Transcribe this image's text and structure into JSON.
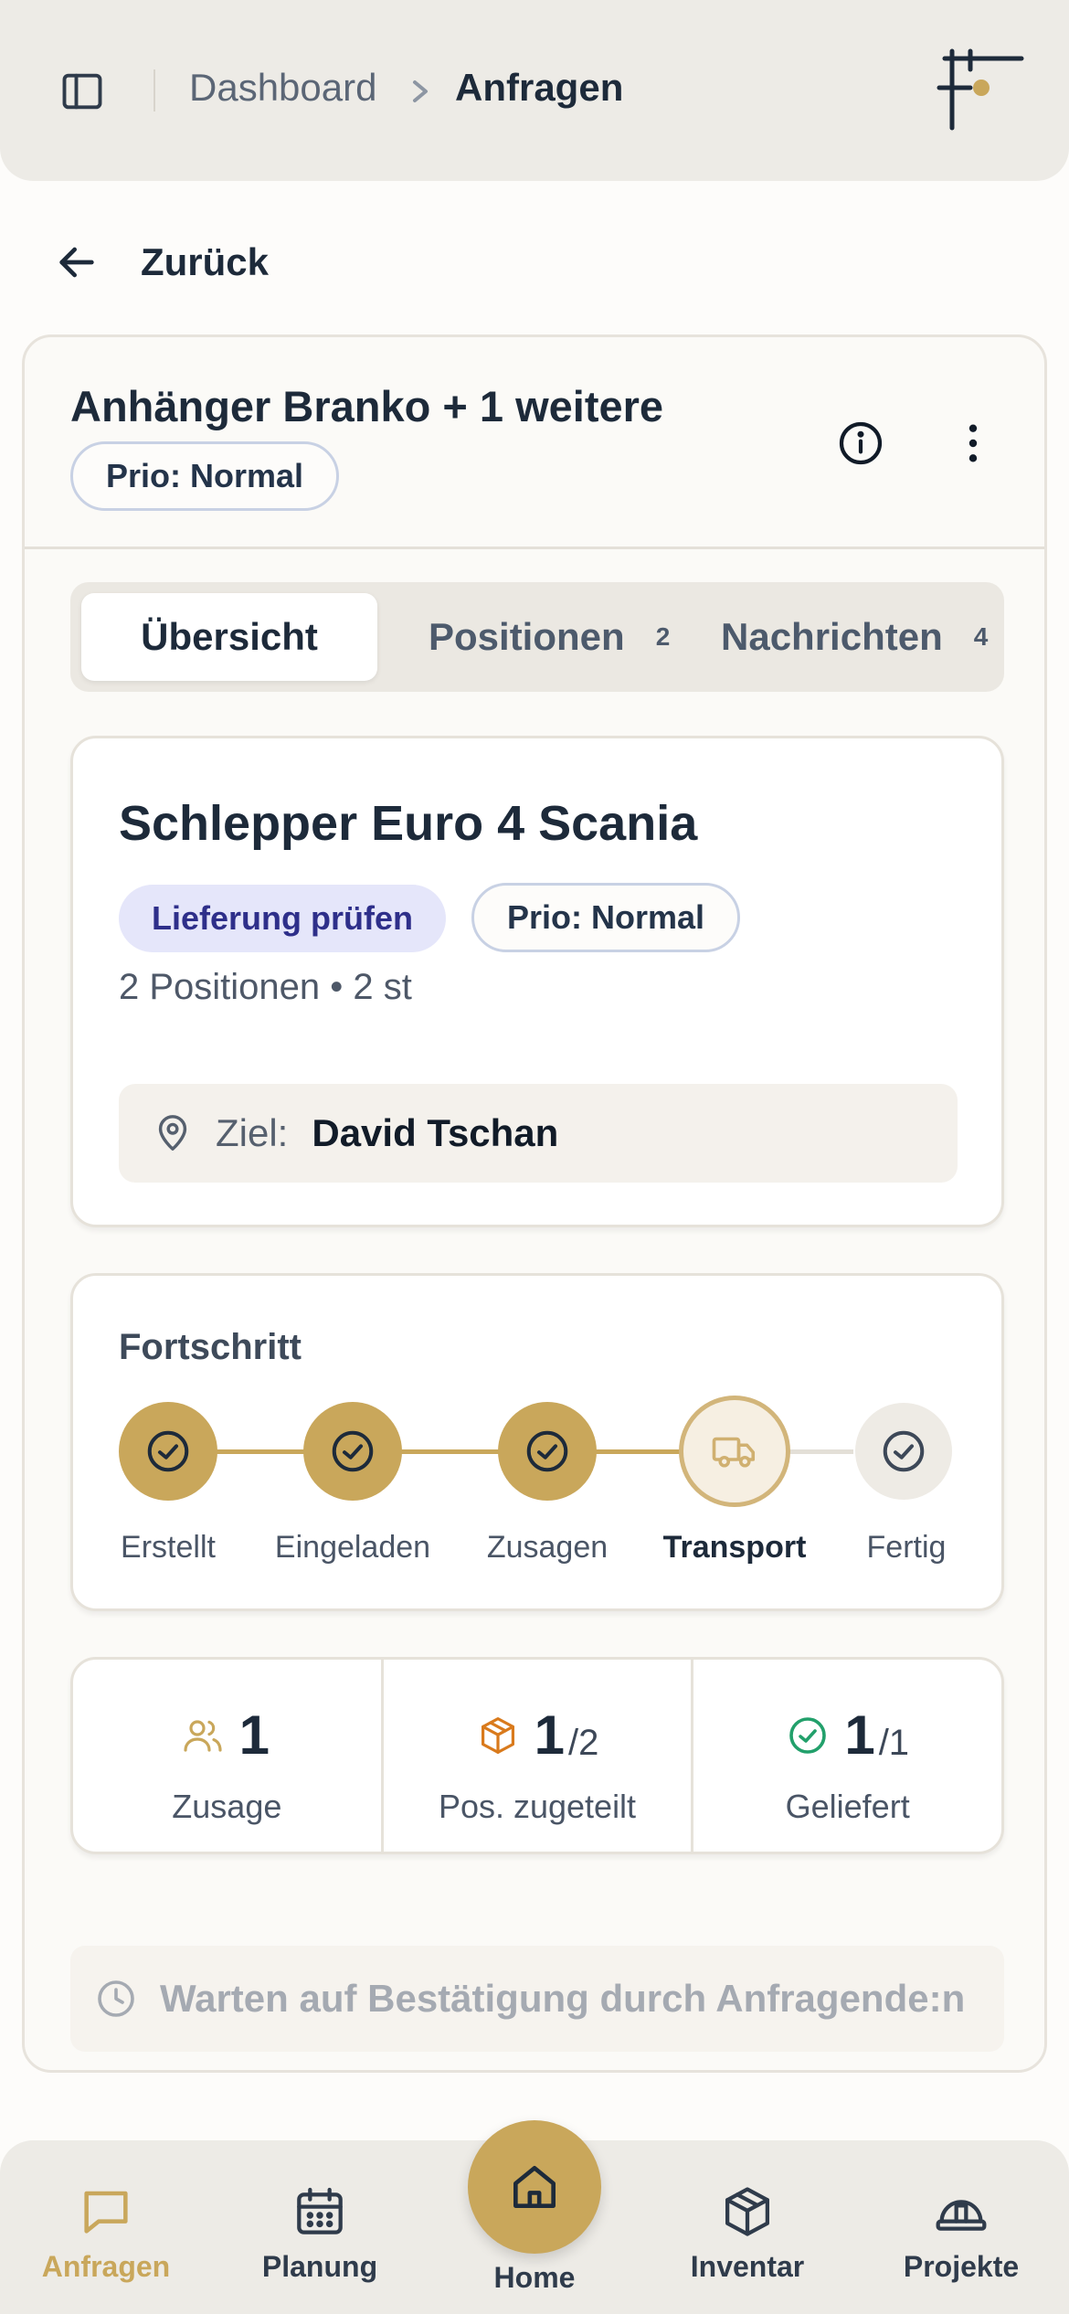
{
  "header": {
    "breadcrumb": [
      "Dashboard",
      "Anfragen"
    ]
  },
  "back": {
    "label": "Zurück"
  },
  "request": {
    "title": "Anhänger Branko + 1 weitere",
    "priority": "Prio: Normal"
  },
  "tabs": [
    {
      "label": "Übersicht",
      "count": ""
    },
    {
      "label": "Positionen",
      "count": "2"
    },
    {
      "label": "Nachrichten",
      "count": "4"
    }
  ],
  "item": {
    "title": "Schlepper Euro 4 Scania",
    "status": "Lieferung prüfen",
    "priority": "Prio: Normal",
    "meta": "2 Positionen • 2 st",
    "target_label": "Ziel:",
    "target_value": "David Tschan"
  },
  "progress": {
    "title": "Fortschritt",
    "steps": [
      {
        "label": "Erstellt",
        "state": "done"
      },
      {
        "label": "Eingeladen",
        "state": "done"
      },
      {
        "label": "Zusagen",
        "state": "done"
      },
      {
        "label": "Transport",
        "state": "current"
      },
      {
        "label": "Fertig",
        "state": "pending"
      }
    ]
  },
  "stats": [
    {
      "value": "1",
      "total": "",
      "label": "Zusage",
      "icon": "users-icon"
    },
    {
      "value": "1",
      "total": "/2",
      "label": "Pos. zugeteilt",
      "icon": "package-icon"
    },
    {
      "value": "1",
      "total": "/1",
      "label": "Geliefert",
      "icon": "check-circle-icon"
    }
  ],
  "waiting": {
    "text": "Warten auf Bestätigung durch Anfragende:n"
  },
  "nav": [
    {
      "label": "Anfragen",
      "icon": "message-icon",
      "active": true
    },
    {
      "label": "Planung",
      "icon": "calendar-icon"
    },
    {
      "label": "Home",
      "icon": "home-icon"
    },
    {
      "label": "Inventar",
      "icon": "box-icon"
    },
    {
      "label": "Projekte",
      "icon": "hardhat-icon"
    }
  ],
  "colors": {
    "accent": "#c9a75b",
    "header_bg": "#edebe6",
    "status_bg": "#e5e6fa",
    "status_text": "#2e2f8a",
    "success": "#22a06b",
    "warning": "#d97a1c"
  }
}
